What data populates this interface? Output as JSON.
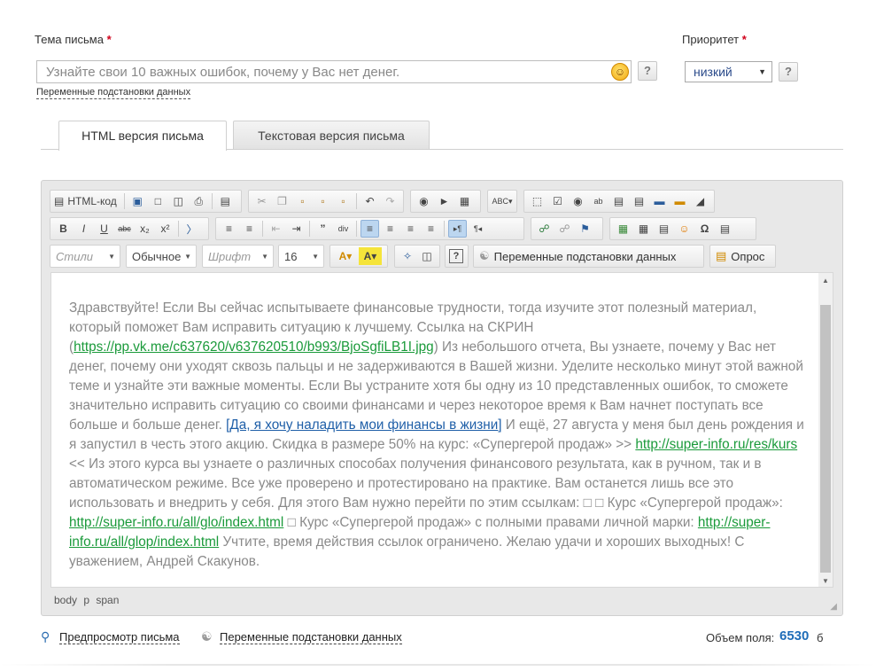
{
  "subject": {
    "label": "Тема письма",
    "required_mark": "*",
    "value": "Узнайте свои 10 важных ошибок, почему у Вас нет денег.",
    "vars_link": "Переменные подстановки данных",
    "help": "?"
  },
  "priority": {
    "label": "Приоритет",
    "required_mark": "*",
    "value": "низкий",
    "help": "?"
  },
  "tabs": [
    {
      "label": "HTML версия письма",
      "active": true
    },
    {
      "label": "Текстовая версия письма",
      "active": false
    }
  ],
  "toolbar": {
    "html_code": "HTML-код",
    "styles": "Стили",
    "format": "Обычное",
    "font": "Шрифт",
    "size": "16",
    "vars_button": "Переменные подстановки данных",
    "poll_button": "Опрос"
  },
  "content": {
    "t1": "Здравствуйте! Если Вы сейчас испытываете финансовые трудности, тогда изучите этот полезный материал, который поможет Вам исправить ситуацию к лучшему. Ссылка на СКРИН (",
    "link1": "https://pp.vk.me/c637620/v637620510/b993/BjoSgfiLB1I.jpg",
    "t2": ") Из небольшого отчета, Вы узнаете, почему у Вас нет денег, почему они уходят сквозь пальцы и не задерживаются в Вашей жизни. Уделите несколько минут этой важной теме и узнайте эти важные моменты. Если Вы устраните хотя бы одну из 10 представленных ошибок, то сможете значительно исправить ситуацию со своими финансами и через некоторое время к Вам начнет поступать все больше и больше денег. ",
    "link2": "[Да, я хочу наладить мои финансы в жизни]",
    "t3": " И ещё, 27 августа у меня был день рождения и я запустил в честь этого акцию. Скидка в размере 50% на курс: «Супергерой продаж» >> ",
    "link3": "http://super-info.ru/res/kurs",
    "t4": " << Из этого курса вы узнаете о различных способах получения финансового результата, как в ручном, так и в автоматическом режиме. Все уже проверено и протестировано на практике. Вам останется лишь все это использовать и внедрить у себя. Для этого Вам нужно перейти по этим ссылкам: □ □ Курс «Супергерой продаж»: ",
    "link4": "http://super-info.ru/all/glo/index.html",
    "t5": " □ Курс «Супергерой продаж» с полными правами личной марки: ",
    "link5": "http://super-info.ru/all/glop/index.html",
    "t6": " Учтите, время действия ссылок ограничено. Желаю удачи и хороших выходных! С уважением, Андрей Скакунов."
  },
  "status_path": "body p span",
  "footer": {
    "preview_link": "Предпросмотр письма",
    "vars_link": "Переменные подстановки данных",
    "volume_label": "Объем поля:",
    "volume_value": "6530",
    "volume_unit": "б"
  }
}
